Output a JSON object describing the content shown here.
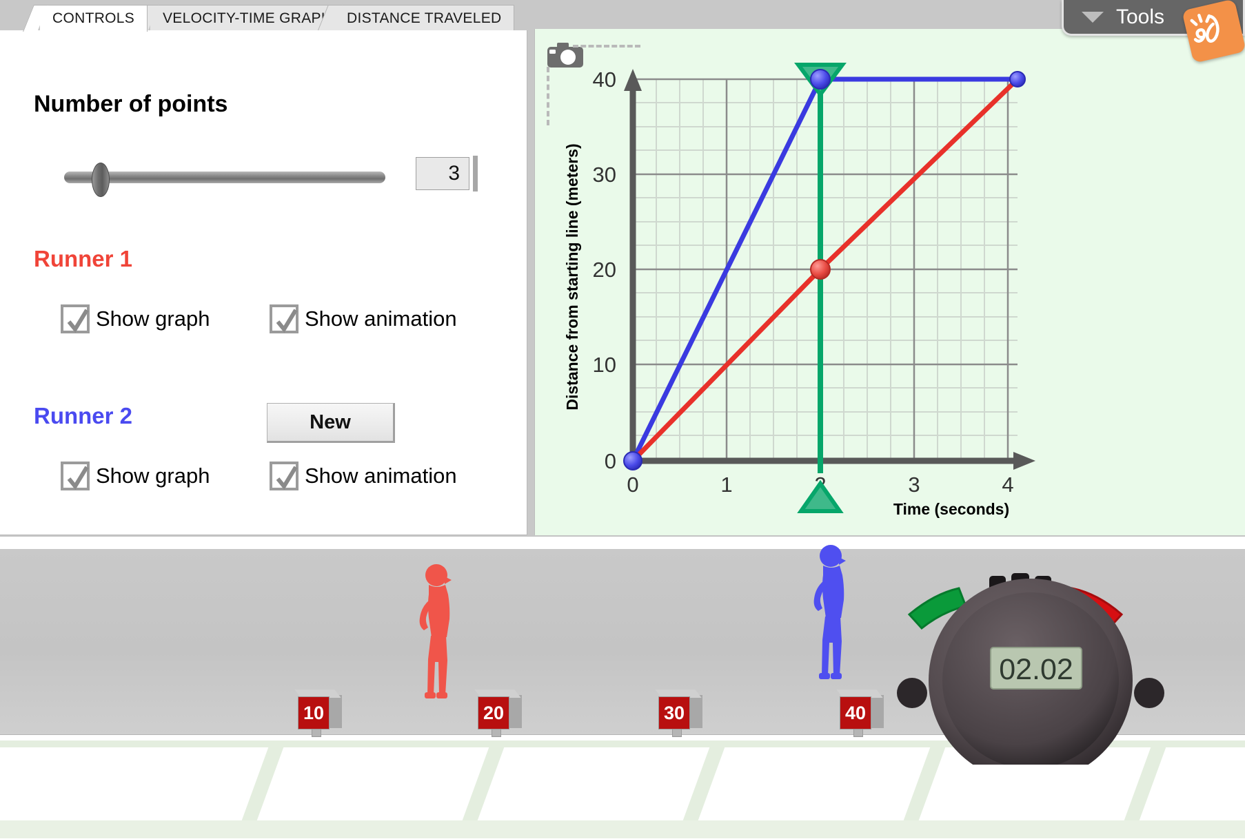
{
  "tabs": [
    {
      "label": "CONTROLS",
      "active": true
    },
    {
      "label": "VELOCITY-TIME GRAPH",
      "active": false
    },
    {
      "label": "DISTANCE TRAVELED",
      "active": false
    }
  ],
  "tools": {
    "label": "Tools",
    "caret_icon": "chevron-down-icon",
    "logo_text": "ël"
  },
  "controls": {
    "points_label": "Number of points",
    "points_value": "3",
    "slider_min": "1",
    "slider_max": "10",
    "runner1": {
      "title": "Runner 1",
      "color": "#f04438",
      "show_graph_label": "Show graph",
      "show_graph_checked": true,
      "show_animation_label": "Show animation",
      "show_animation_checked": true
    },
    "runner2": {
      "title": "Runner 2",
      "color": "#4a4af0",
      "show_graph_label": "Show graph",
      "show_graph_checked": true,
      "show_animation_label": "Show animation",
      "show_animation_checked": true,
      "new_button_label": "New"
    }
  },
  "graph_panel": {
    "camera_icon": "camera-icon",
    "background_color": "#eafaea"
  },
  "chart_data": {
    "type": "line",
    "title": "",
    "xlabel": "Time (seconds)",
    "ylabel": "Distance from starting line (meters)",
    "xlim": [
      0,
      4
    ],
    "ylim": [
      0,
      40
    ],
    "xticks": [
      0,
      1,
      2,
      3,
      4
    ],
    "xticklabels": [
      "0",
      "1",
      "2",
      "3",
      "4"
    ],
    "yticks": [
      0,
      10,
      20,
      30,
      40
    ],
    "yticklabels": [
      "0",
      "10",
      "20",
      "30",
      "40"
    ],
    "grid": true,
    "grid_minor": true,
    "legend": "none",
    "series": [
      {
        "name": "Runner 2",
        "color": "#3a3ae0",
        "x": [
          0,
          2,
          4
        ],
        "y": [
          0,
          40,
          40
        ],
        "markers": [
          {
            "x": 0,
            "y": 0
          },
          {
            "x": 2,
            "y": 40
          },
          {
            "x": 4,
            "y": 40
          }
        ]
      },
      {
        "name": "Runner 1",
        "color": "#e8312a",
        "x": [
          0,
          2,
          4
        ],
        "y": [
          0,
          20,
          40
        ],
        "markers": [
          {
            "x": 2,
            "y": 20
          }
        ]
      }
    ],
    "time_cursor": {
      "name": "time-marker",
      "x": 2,
      "color": "#06a66a",
      "top_icon": "triangle-down-icon",
      "bottom_icon": "triangle-up-icon"
    }
  },
  "animation": {
    "markers": [
      {
        "label": "10"
      },
      {
        "label": "20"
      },
      {
        "label": "30"
      },
      {
        "label": "40"
      }
    ],
    "runner1_color": "#f0554a",
    "runner2_color": "#4f4ff0",
    "stopwatch": {
      "display": "02.02",
      "start_button_color": "#0a9a3a",
      "stop_button_color": "#d60f12"
    }
  }
}
